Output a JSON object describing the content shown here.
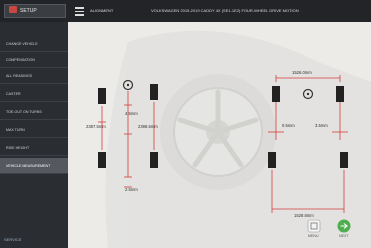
{
  "topbar": {
    "setup_label": "SETUP",
    "section_label": "ALIGNMENT",
    "vehicle_label": "VOLKSWAGEN 2015-2019 CADDY 4X (SE1-1E2) FOUR-WHEEL DRIVE MOTION"
  },
  "sidebar": {
    "items": [
      {
        "label": "CHANGE VEHICLE"
      },
      {
        "label": "COMPENSATION"
      },
      {
        "label": "ALL READINGS"
      },
      {
        "label": "CASTER"
      },
      {
        "label": "TOE-OUT ON TURNS"
      },
      {
        "label": "MAX TURN"
      },
      {
        "label": "RIDE HEIGHT"
      },
      {
        "label": "VEHICLE MEASUREMENT"
      }
    ],
    "active_index": 7,
    "footer": "SERVICE"
  },
  "measurements": {
    "left_top_offset": "4.5mm",
    "left_wheelbase_left": "2387.5mm",
    "left_wheelbase_right": "2398.5mm",
    "left_bottom_offset": "2.5mm",
    "right_front_track": "1526.0mm",
    "right_setback_left": "0.5mm",
    "right_setback_right": "3.5mm",
    "right_rear_track": "1528.8mm"
  },
  "buttons": {
    "left_label": "MENU",
    "right_label": "NEXT"
  },
  "colors": {
    "accent_red": "#c9473f",
    "dim_line": "#d23c3c",
    "next_green": "#4fae4f"
  }
}
